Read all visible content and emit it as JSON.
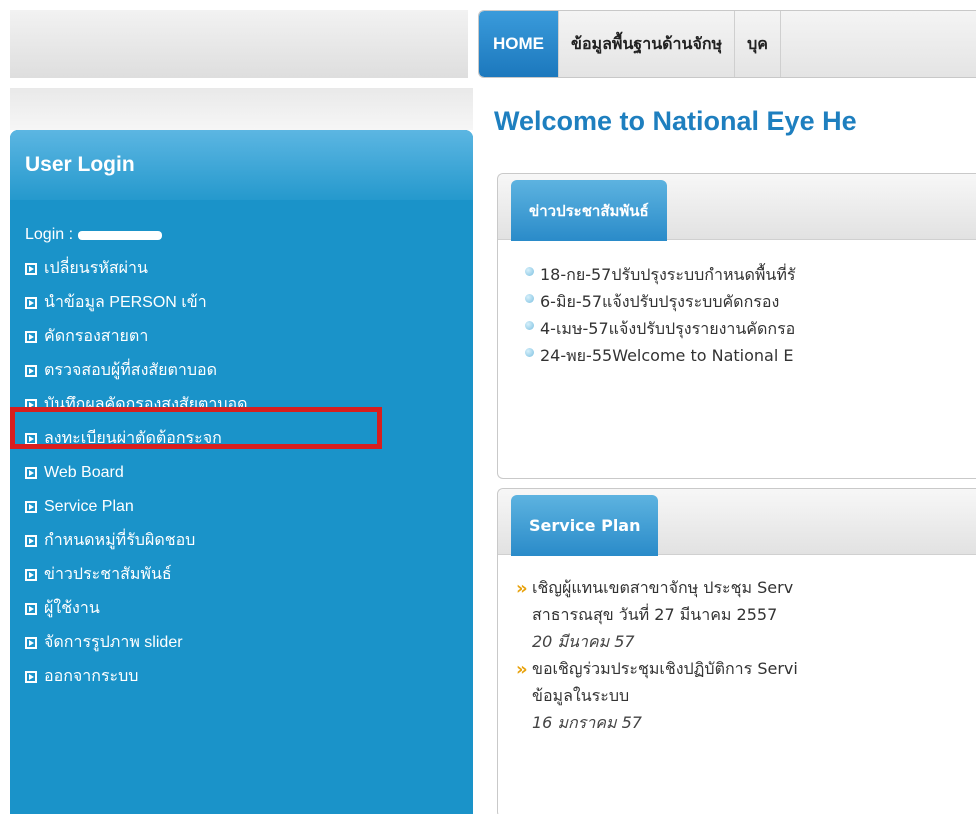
{
  "nav": {
    "tabs": [
      {
        "label": "HOME",
        "active": true
      },
      {
        "label": "ข้อมูลพื้นฐานด้านจักษุ",
        "active": false
      },
      {
        "label": "บุค",
        "active": false
      }
    ]
  },
  "login": {
    "title": "User Login",
    "login_label": "Login :",
    "menu": [
      "เปลี่ยนรหัสผ่าน",
      "นำข้อมูล PERSON เข้า",
      "คัดกรองสายตา",
      "ตรวจสอบผู้ที่สงสัยตาบอด",
      "บันทึกผลคัดกรองสงสัยตาบอด",
      "ลงทะเบียนผ่าตัดต้อกระจก",
      "Web Board",
      "Service Plan",
      "กำหนดหมู่ที่รับผิดชอบ",
      "ข่าวประชาสัมพันธ์",
      "ผู้ใช้งาน",
      "จัดการรูปภาพ slider",
      "ออกจากระบบ"
    ]
  },
  "main": {
    "welcome": "Welcome to National Eye He",
    "news": {
      "tab": "ข่าวประชาสัมพันธ์",
      "items": [
        "18-กย-57ปรับปรุงระบบกำหนดพื้นที่รั",
        "6-มิย-57แจ้งปรับปรุงระบบคัดกรอง",
        "4-เมษ-57แจ้งปรับปรุงรายงานคัดกรอ",
        "24-พย-55Welcome to National E"
      ]
    },
    "service_plan": {
      "tab": "Service Plan",
      "item1_line1": "เชิญผู้แทนเขตสาขาจักษุ ประชุม Serv",
      "item1_line2": "สาธารณสุข วันที่ 27 มีนาคม 2557",
      "item1_date": "20 มีนาคม 57",
      "item2_line1": "ขอเชิญร่วมประชุมเชิงปฏิบัติการ Servi",
      "item2_line2": "ข้อมูลในระบบ",
      "item2_date": "16 มกราคม 57"
    }
  },
  "colors": {
    "sidebar": "#1a93c9",
    "accent": "#1e7fbf",
    "highlight": "#d81e1e"
  }
}
